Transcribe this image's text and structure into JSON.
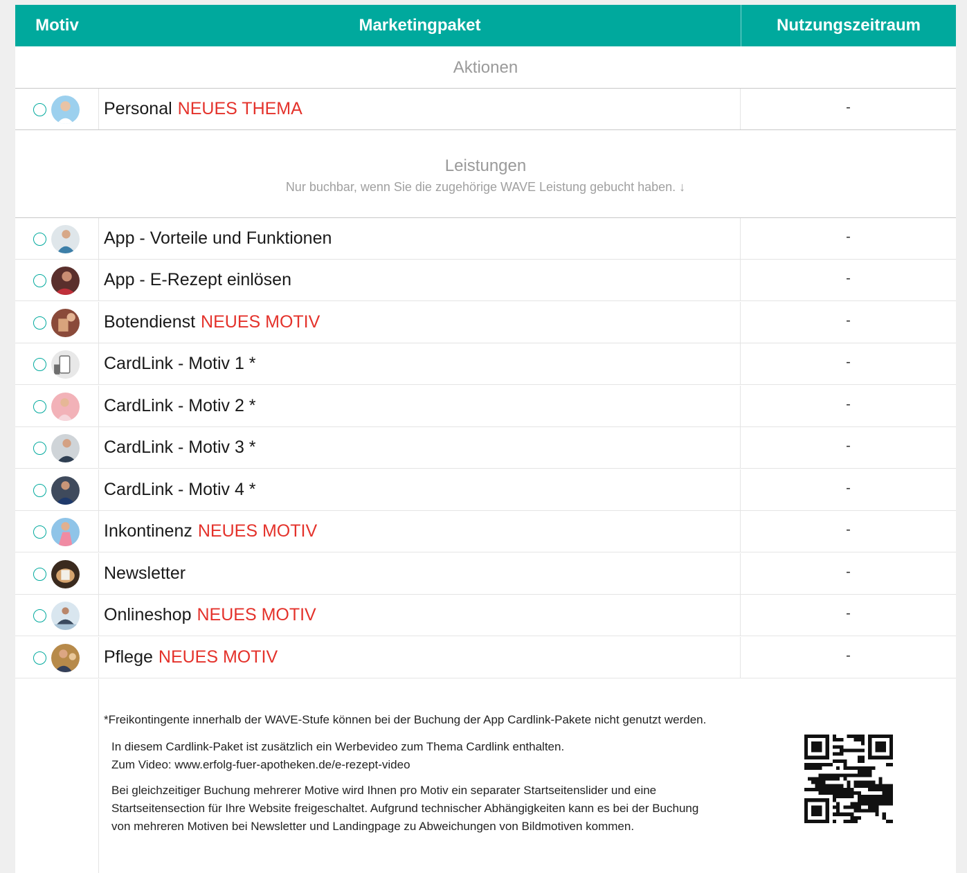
{
  "table": {
    "headers": {
      "motiv": "Motiv",
      "paket": "Marketingpaket",
      "zeitraum": "Nutzungszeitraum"
    },
    "sections": {
      "aktionen": {
        "title": "Aktionen"
      },
      "leistungen": {
        "title": "Leistungen",
        "subtitle": "Nur buchbar, wenn Sie die zugehörige WAVE Leistung gebucht haben. ↓"
      }
    },
    "rows": [
      {
        "label": "Personal",
        "tag": "NEUES THEMA",
        "zeitraum": "-"
      },
      {
        "label": "App - Vorteile und Funktionen",
        "tag": "",
        "zeitraum": "-"
      },
      {
        "label": "App - E-Rezept einlösen",
        "tag": "",
        "zeitraum": "-"
      },
      {
        "label": "Botendienst",
        "tag": "NEUES MOTIV",
        "zeitraum": "-"
      },
      {
        "label": "CardLink - Motiv 1 *",
        "tag": "",
        "zeitraum": "-"
      },
      {
        "label": "CardLink - Motiv 2 *",
        "tag": "",
        "zeitraum": "-"
      },
      {
        "label": "CardLink - Motiv 3 *",
        "tag": "",
        "zeitraum": "-"
      },
      {
        "label": "CardLink - Motiv 4 *",
        "tag": "",
        "zeitraum": "-"
      },
      {
        "label": "Inkontinenz",
        "tag": "NEUES MOTIV",
        "zeitraum": "-"
      },
      {
        "label": "Newsletter",
        "tag": "",
        "zeitraum": "-"
      },
      {
        "label": "Onlineshop",
        "tag": "NEUES MOTIV",
        "zeitraum": "-"
      },
      {
        "label": "Pflege",
        "tag": "NEUES MOTIV",
        "zeitraum": "-"
      }
    ]
  },
  "footer": {
    "note1": "*Freikontingente innerhalb der WAVE-Stufe können bei der Buchung der App Cardlink-Pakete nicht genutzt werden.",
    "note2_line1": "In diesem Cardlink-Paket ist zusätzlich ein Werbevideo zum Thema Cardlink enthalten.",
    "note2_line2": "Zum Video: www.erfolg-fuer-apotheken.de/e-rezept-video",
    "note3": "Bei gleichzeitiger Buchung mehrerer Motive wird Ihnen pro Motiv ein separater Startseitenslider und eine Startseitensection für Ihre Website freigeschaltet. Aufgrund technischer Abhängigkeiten kann es bei der Buchung von mehreren Motiven bei Newsletter und Landingpage zu Abweichungen von Bildmotiven kommen."
  },
  "colors": {
    "accent": "#00a99d",
    "tag": "#e4322b",
    "section_text": "#9a9a9a"
  }
}
